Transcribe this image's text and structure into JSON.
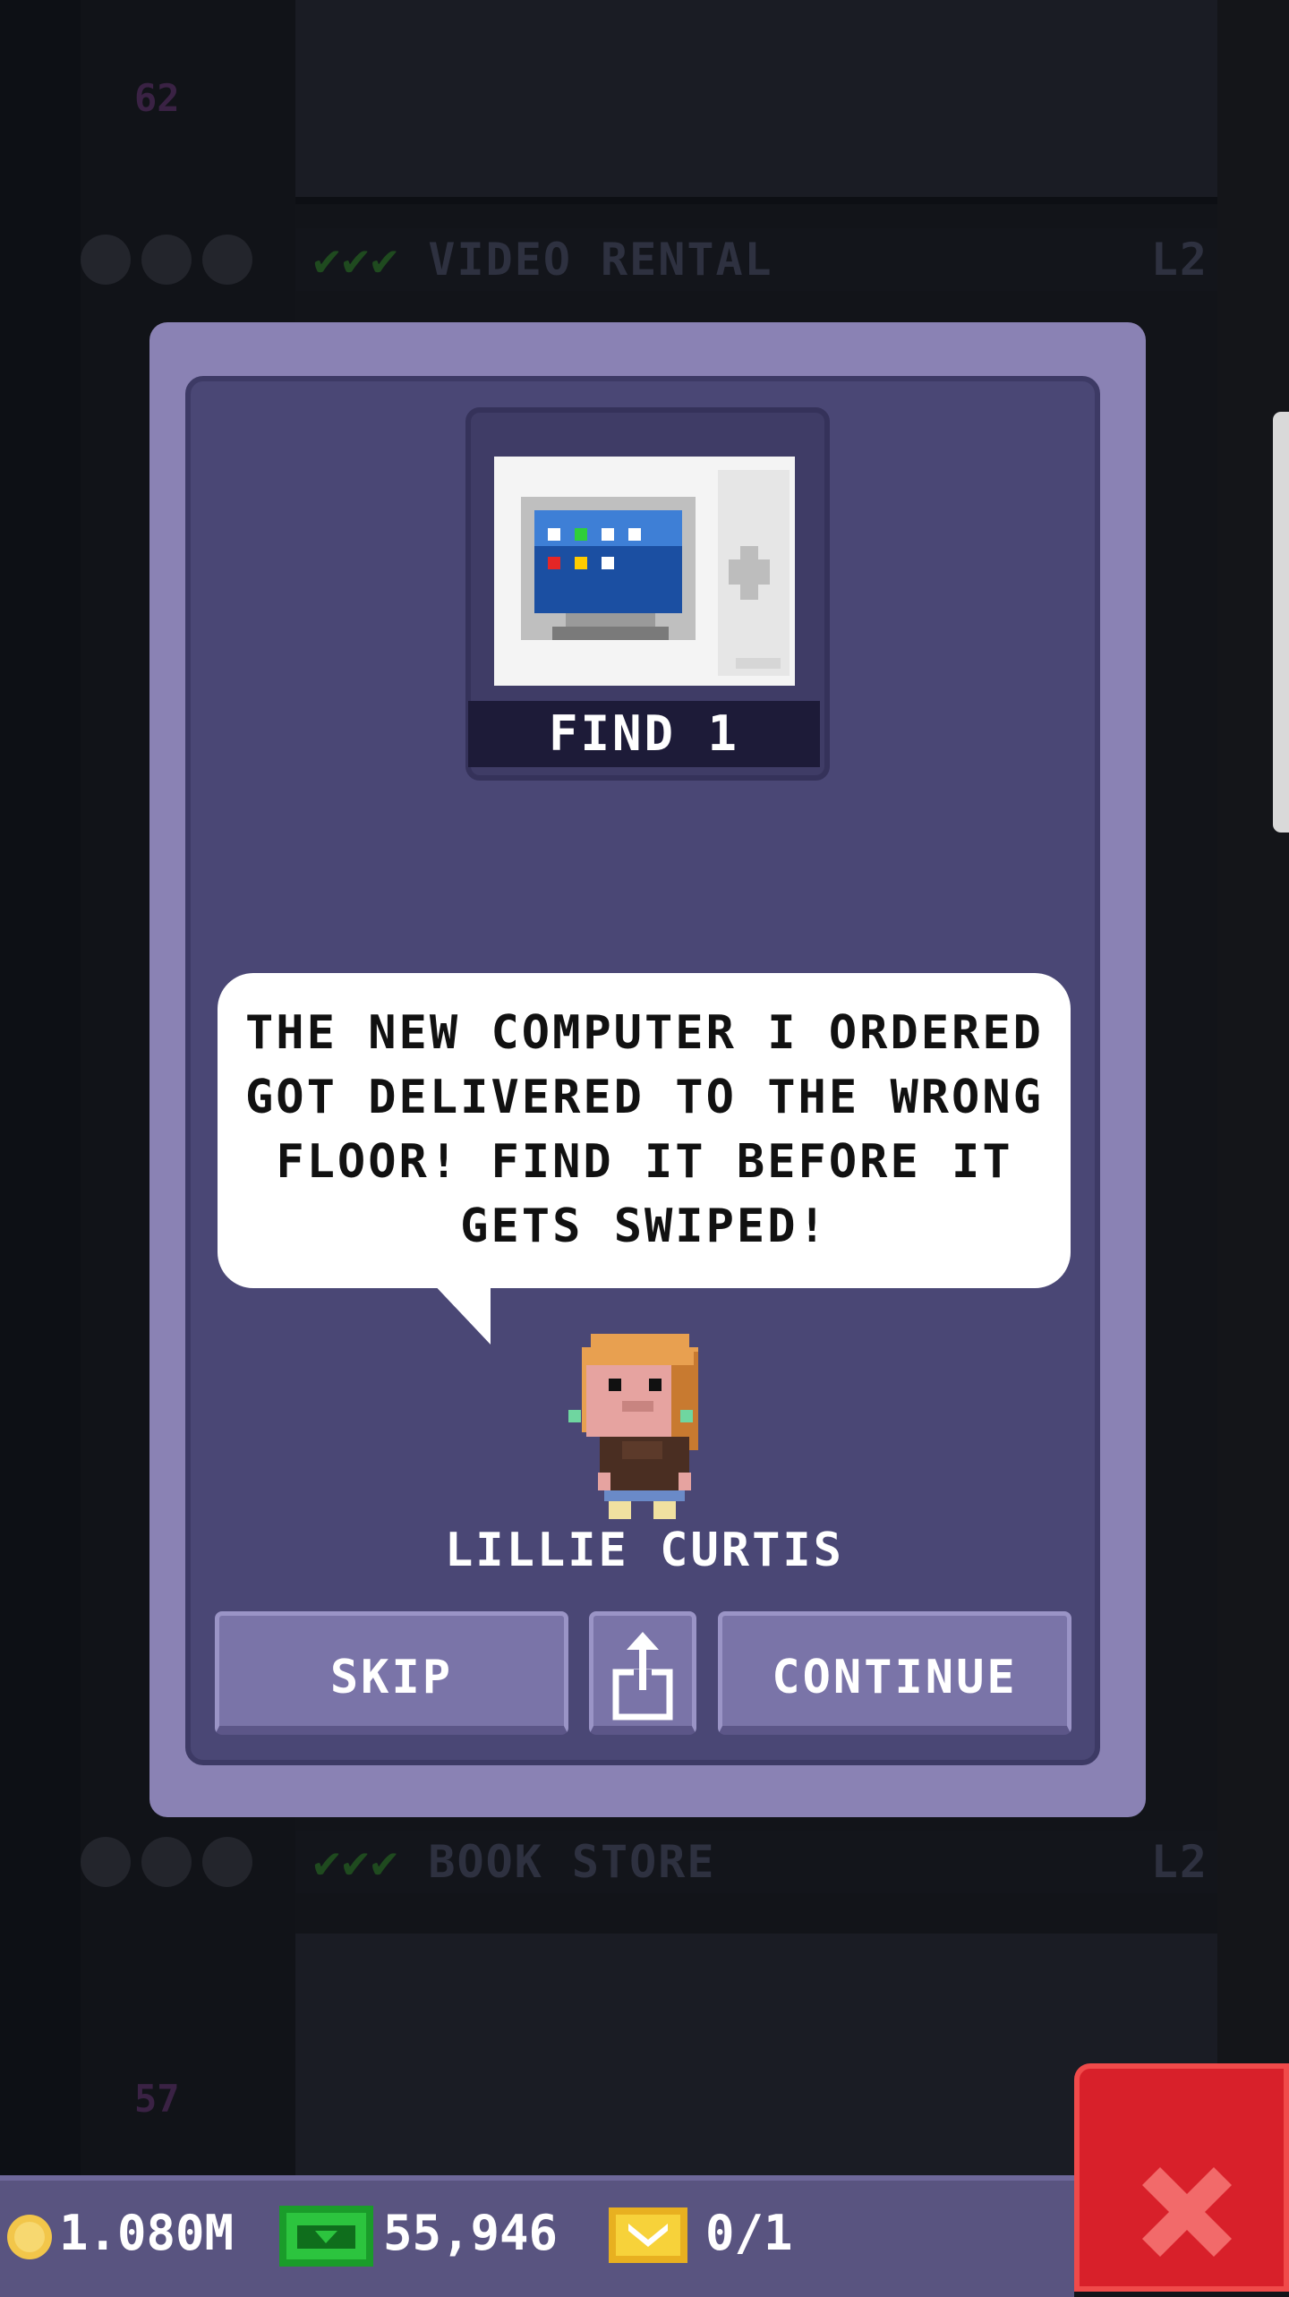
{
  "background": {
    "floors": [
      {
        "name": "VIDEO RENTAL",
        "level": "L2",
        "checks": "✔✔✔",
        "number": "62"
      },
      {
        "name": "BOOK STORE",
        "level": "L2",
        "checks": "✔✔✔",
        "number": "57"
      }
    ]
  },
  "dialog": {
    "find_label": "FIND 1",
    "item_icon": "computer-icon",
    "speech": "THE NEW COMPUTER I ORDERED GOT DELIVERED TO THE WRONG FLOOR! FIND IT BEFORE IT GETS SWIPED!",
    "npc_name": "LILLIE CURTIS",
    "buttons": {
      "skip": "SKIP",
      "share_icon": "share-icon",
      "continue": "CONTINUE"
    }
  },
  "status_bar": {
    "coins": "1.080M",
    "bux": "55,946",
    "tickets": "0/1"
  },
  "colors": {
    "dialog_outer": "#8a82b4",
    "dialog_inner": "#4a4775",
    "close_red": "#d8202a"
  }
}
